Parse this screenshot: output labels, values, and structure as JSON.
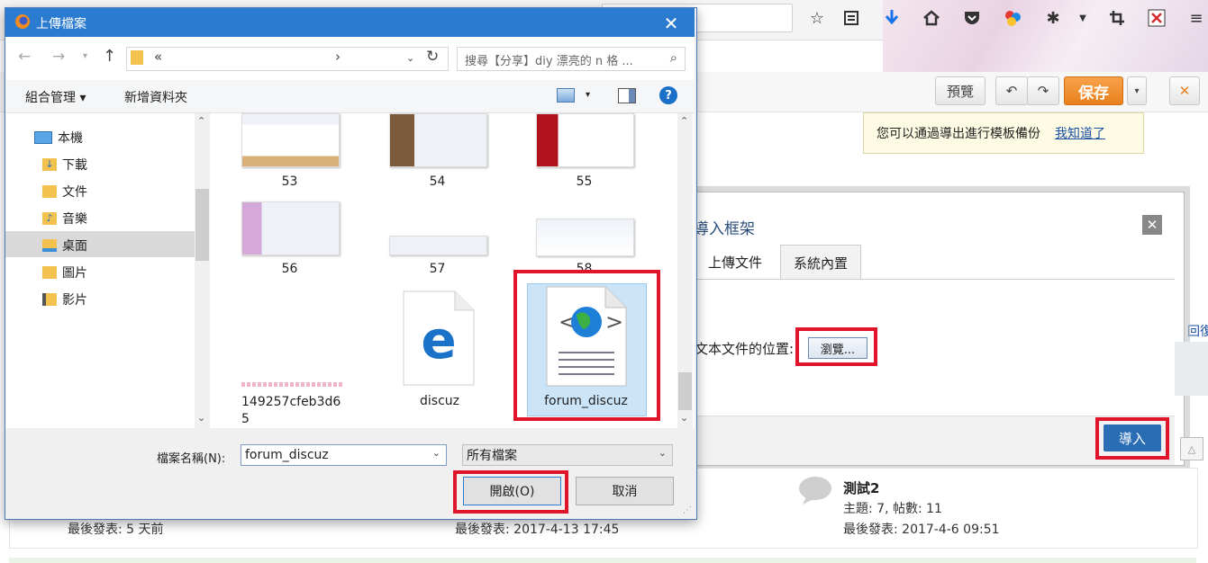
{
  "colors": {
    "accent": "#2b7bd0",
    "highlight": "#e0142a",
    "save_orange": "#f0902f",
    "import_blue": "#2a6db5"
  },
  "browser": {
    "toolbar_icons": [
      "star-icon",
      "reading-list-icon",
      "download-icon",
      "home-icon",
      "pocket-icon",
      "colorful-extension-icon",
      "spider-extension-icon",
      "crop-icon",
      "close-extension-icon",
      "hamburger-menu-icon"
    ]
  },
  "editor": {
    "preview_label": "預覽",
    "save_label": "保存",
    "close_label": "✕",
    "tooltip_text": "您可以通過導出進行模板備份",
    "tooltip_link": "我知道了"
  },
  "import_dialog": {
    "title": "導入框架",
    "close_label": "✕",
    "tabs": [
      {
        "label": "上傳文件"
      },
      {
        "label": "系統內置"
      }
    ],
    "location_label": "文本文件的位置:",
    "browse_label": "瀏覽...",
    "import_label": "導入",
    "side_text": "回復"
  },
  "forum": {
    "cols": [
      {
        "last_post": "最後發表: 5 天前"
      },
      {
        "last_post": "最後發表: 2017-4-13 17:45"
      },
      {
        "title": "測試2",
        "stats": "主題: 7, 帖數: 11",
        "last_post": "最後發表: 2017-4-6 09:51"
      }
    ]
  },
  "file_dialog": {
    "title": "上傳檔案",
    "close_label": "✕",
    "address_text": "«",
    "address_sep": "›",
    "search_placeholder": "搜尋【分享】diy 漂亮的 n 格 ...",
    "organize_label": "組合管理 ▾",
    "new_folder_label": "新增資料夾",
    "nav": [
      {
        "label": "本機"
      },
      {
        "label": "下載"
      },
      {
        "label": "文件"
      },
      {
        "label": "音樂"
      },
      {
        "label": "桌面"
      },
      {
        "label": "圖片"
      },
      {
        "label": "影片"
      }
    ],
    "files": [
      {
        "name": "53"
      },
      {
        "name": "54"
      },
      {
        "name": "55"
      },
      {
        "name": "56"
      },
      {
        "name": "57"
      },
      {
        "name": "58"
      },
      {
        "name": "149257cfeb3d65"
      },
      {
        "name": "discuz"
      },
      {
        "name": "forum_discuz"
      }
    ],
    "filename_label": "檔案名稱(N):",
    "filename_value": "forum_discuz",
    "filetype_value": "所有檔案",
    "open_label": "開啟(O)",
    "cancel_label": "取消"
  }
}
